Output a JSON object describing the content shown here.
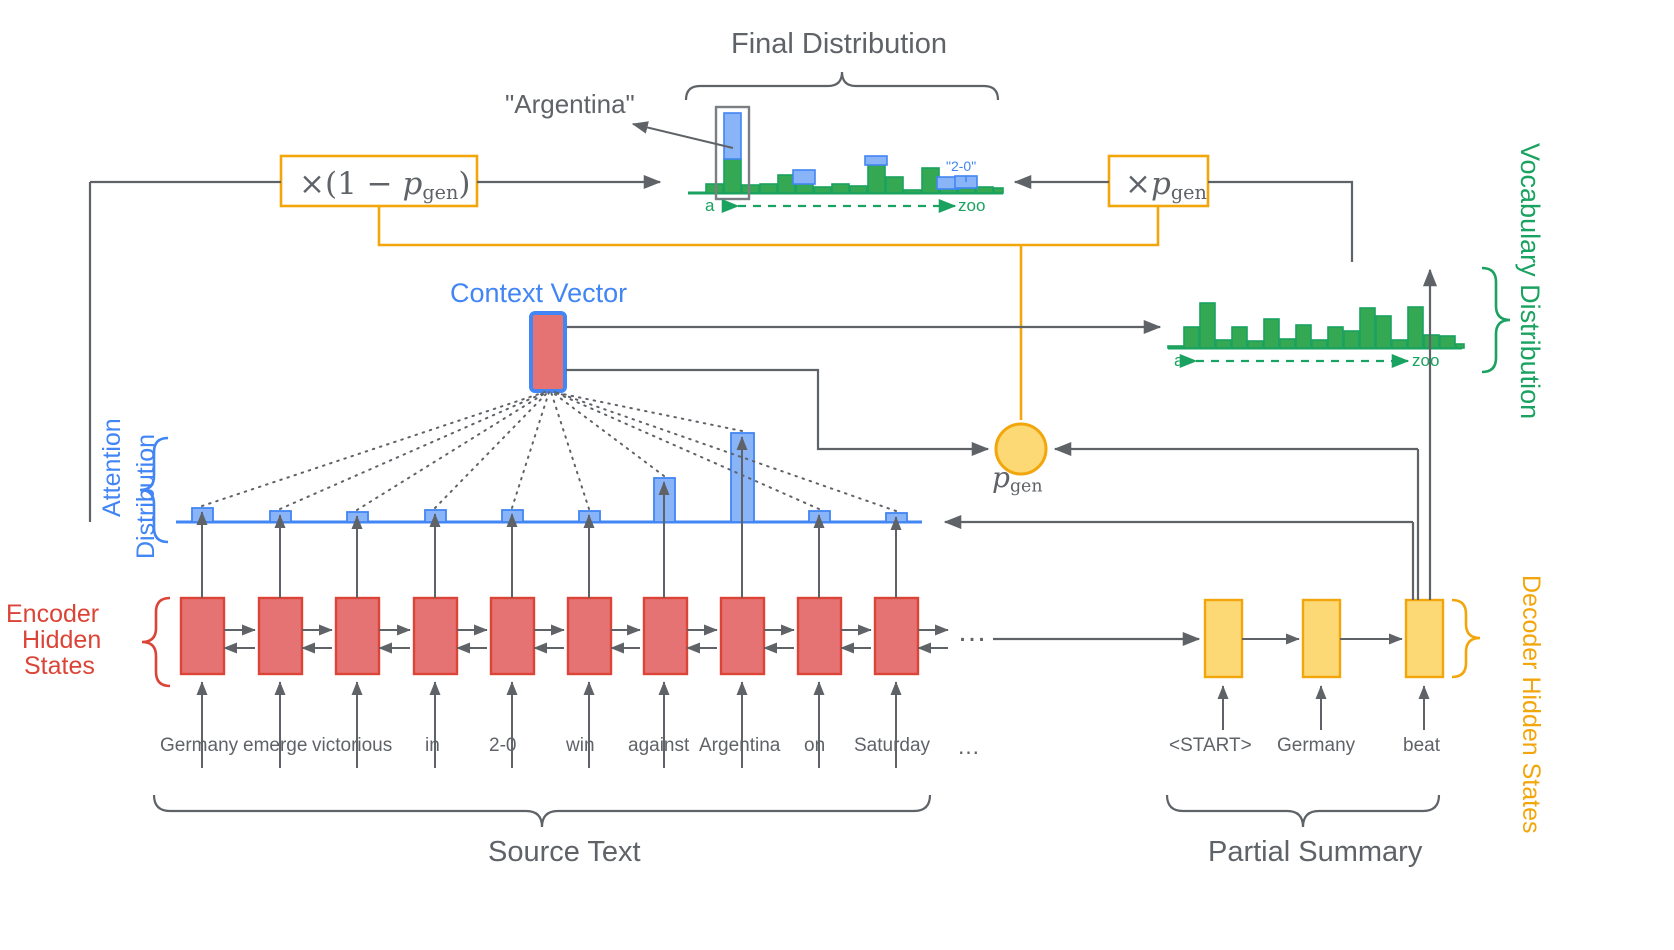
{
  "title_labels": {
    "final_distribution": "Final Distribution",
    "vocabulary_distribution": "Vocabulary Distribution",
    "attention_distribution_l1": "Attention",
    "attention_distribution_l2": "Distribution",
    "encoder_hidden_l1": "Encoder",
    "encoder_hidden_l2": "Hidden",
    "encoder_hidden_l3": "States",
    "decoder_hidden_states": "Decoder Hidden States",
    "context_vector": "Context Vector",
    "source_text": "Source Text",
    "partial_summary": "Partial Summary"
  },
  "callouts": {
    "argentina": "\"Argentina\"",
    "two_nil": "\"2-0\""
  },
  "formulas": {
    "one_minus_pgen_prefix": "×(1 − ",
    "one_minus_pgen_suffix": ")",
    "times_prefix": "×",
    "p": "p",
    "gen": "gen",
    "pgen_circle_label_p": "p",
    "pgen_circle_label_sub": "gen"
  },
  "axis": {
    "start": "a",
    "end": "zoo"
  },
  "source_text_tokens": [
    "Germany",
    "emerge",
    "victorious",
    "in",
    "2-0",
    "win",
    "against",
    "Argentina",
    "on",
    "Saturday",
    "…"
  ],
  "summary_tokens": [
    "<START>",
    "Germany",
    "beat"
  ],
  "encoder_ellipsis": "…",
  "colors": {
    "gray": "#5f6368",
    "blue": "#4285f4",
    "blue_fill": "#8ab4f8",
    "green": "#1aa260",
    "green_fill": "#34a853",
    "red": "#db4437",
    "red_fill": "#e57373",
    "orange": "#f2a60c",
    "orange_fill": "#fcd975"
  },
  "chart_data": [
    {
      "type": "bar",
      "title": "Attention Distribution",
      "name": "attention-distribution",
      "categories": [
        "Germany",
        "emerge",
        "victorious",
        "in",
        "2-0",
        "win",
        "against",
        "Argentina",
        "on",
        "Saturday"
      ],
      "values": [
        0.06,
        0.05,
        0.04,
        0.05,
        0.05,
        0.05,
        0.28,
        0.5,
        0.05,
        0.04
      ],
      "ylim": [
        0,
        0.55
      ],
      "xlabel": "",
      "ylabel": "",
      "grid": false,
      "legend": "none",
      "color": "#8ab4f8"
    },
    {
      "type": "bar",
      "title": "Vocabulary Distribution",
      "name": "vocabulary-distribution",
      "xlabel": "a → zoo",
      "ylabel": "",
      "grid": false,
      "legend": "none",
      "color": "#34a853",
      "x": [
        "a",
        "...",
        "...",
        "...",
        "...",
        "...",
        "...",
        "...",
        "...",
        "...",
        "...",
        "...",
        "...",
        "...",
        "...",
        "...",
        "...",
        "...",
        "zoo"
      ],
      "values": [
        0.02,
        0.26,
        0.56,
        0.1,
        0.26,
        0.09,
        0.36,
        0.11,
        0.28,
        0.1,
        0.26,
        0.21,
        0.49,
        0.39,
        0.1,
        0.5,
        0.16,
        0.15,
        0.05
      ]
    },
    {
      "type": "bar",
      "title": "Final Distribution",
      "name": "final-distribution",
      "xlabel": "a → zoo",
      "ylabel": "",
      "grid": false,
      "legend": "none",
      "series": [
        {
          "name": "vocabulary (green)",
          "color": "#34a853",
          "values": [
            0.09,
            0.33,
            0.08,
            0.09,
            0.18,
            0.1,
            0.06,
            0.09,
            0.07,
            0.3,
            0.16,
            0.03,
            0.25,
            0.05,
            0.09,
            0.06,
            0.05
          ]
        },
        {
          "name": "attention (blue)",
          "color": "#8ab4f8",
          "values": [
            0.0,
            0.62,
            0.0,
            0.0,
            0.0,
            0.13,
            0.0,
            0.0,
            0.0,
            0.08,
            0.0,
            0.0,
            0.0,
            0.12,
            0.0,
            0.12,
            0.0
          ]
        }
      ],
      "highlighted_bar_index": 1,
      "highlight_label": "\"Argentina\"",
      "annotated_bar_index": 15,
      "annotation_label": "\"2-0\""
    }
  ]
}
